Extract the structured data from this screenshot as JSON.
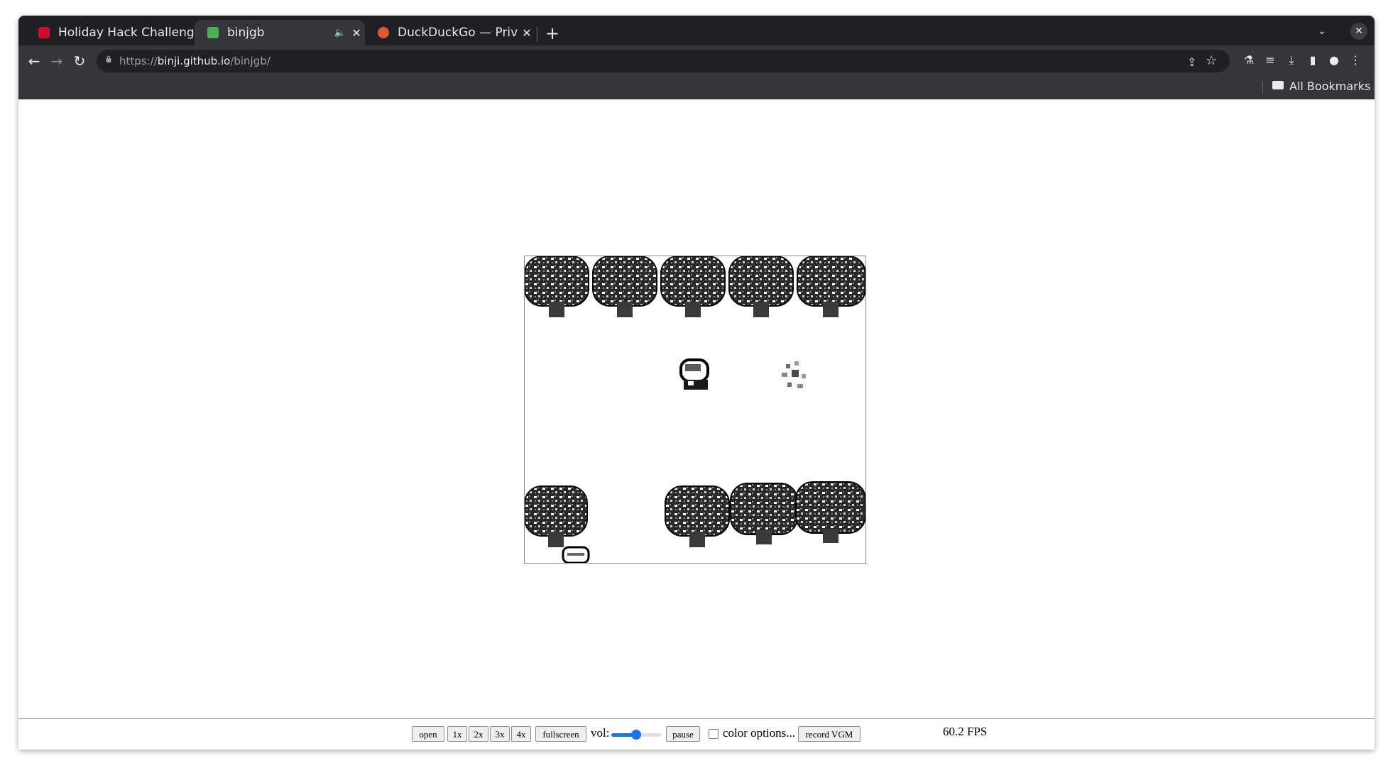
{
  "tabs": [
    {
      "title": "Holiday Hack Challeng",
      "close": "✕",
      "favicon_color": "#c8102e"
    },
    {
      "title": "binjgb",
      "close": "✕",
      "audio": "🔈",
      "favicon_color": "#4caf50"
    },
    {
      "title": "DuckDuckGo — Privac",
      "close": "✕",
      "favicon_color": "#de5833"
    }
  ],
  "new_tab": "+",
  "tab_search_icon": "⌄",
  "window_close": "✕",
  "nav": {
    "back": "←",
    "forward": "→",
    "reload": "↻"
  },
  "address": {
    "scheme": "https://",
    "host": "binji.github.io",
    "path": "/binjgb/"
  },
  "omnibox_icons": {
    "share": "⇪",
    "star": "☆"
  },
  "toolbar_icons": [
    "flask-icon",
    "media-icon",
    "download-icon",
    "sidepanel-icon",
    "profile-icon",
    "menu-icon"
  ],
  "toolbar_glyphs": {
    "flask": "⚗",
    "media": "≡",
    "download": "⤓",
    "sidepanel": "▮",
    "profile": "●",
    "menu": "⋮"
  },
  "bookmarks": {
    "all_bookmarks": "All Bookmarks"
  },
  "emulator": {
    "buttons": {
      "open": "open",
      "1x": "1x",
      "2x": "2x",
      "3x": "3x",
      "4x": "4x",
      "fullscreen": "fullscreen",
      "pause": "pause",
      "record": "record VGM"
    },
    "vol_label": "vol:",
    "volume": 0.5,
    "color_options": "color options...",
    "color_options_checked": false,
    "fps": "60.2 FPS"
  },
  "colors": {
    "accent": "#1a73e8",
    "tabstrip": "#1f2023",
    "toolbar": "#35363a"
  }
}
